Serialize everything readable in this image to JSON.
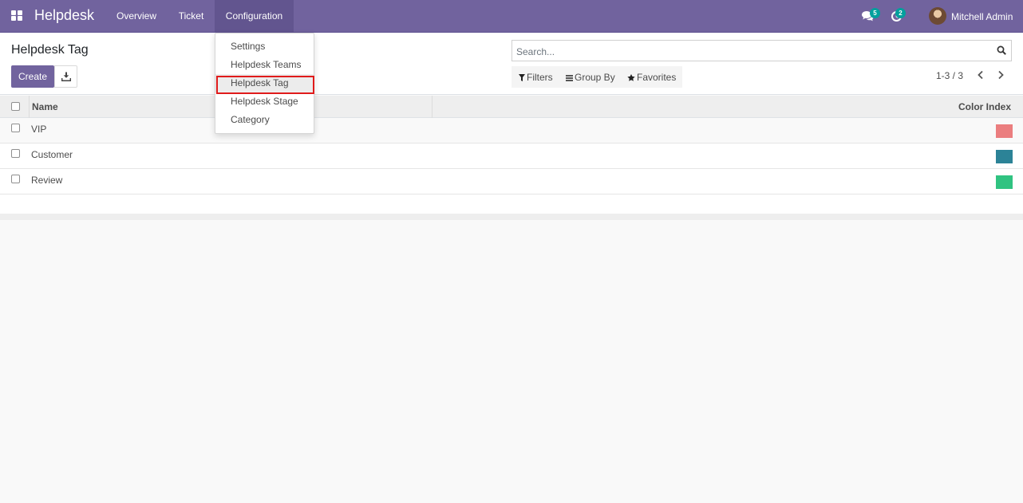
{
  "navbar": {
    "brand": "Helpdesk",
    "menu": [
      "Overview",
      "Ticket",
      "Configuration"
    ],
    "active_menu": "Configuration",
    "messages_badge": "5",
    "activities_badge": "2",
    "user_name": "Mitchell Admin",
    "color": "#71639e"
  },
  "control_panel": {
    "title": "Helpdesk Tag",
    "create_label": "Create",
    "search_placeholder": "Search...",
    "filters_label": "Filters",
    "groupby_label": "Group By",
    "favorites_label": "Favorites",
    "pager": "1-3 / 3"
  },
  "list": {
    "columns": [
      "Name",
      "Color Index"
    ],
    "rows": [
      {
        "name": "VIP",
        "color": "#eb7e7f"
      },
      {
        "name": "Customer",
        "color": "#2c8397"
      },
      {
        "name": "Review",
        "color": "#30c381"
      }
    ]
  },
  "dropdown": {
    "items": [
      "Settings",
      "Helpdesk Teams",
      "Helpdesk Tag",
      "Helpdesk Stage",
      "Category"
    ],
    "highlighted": "Helpdesk Tag",
    "highlight_color": "#e01b1b"
  }
}
